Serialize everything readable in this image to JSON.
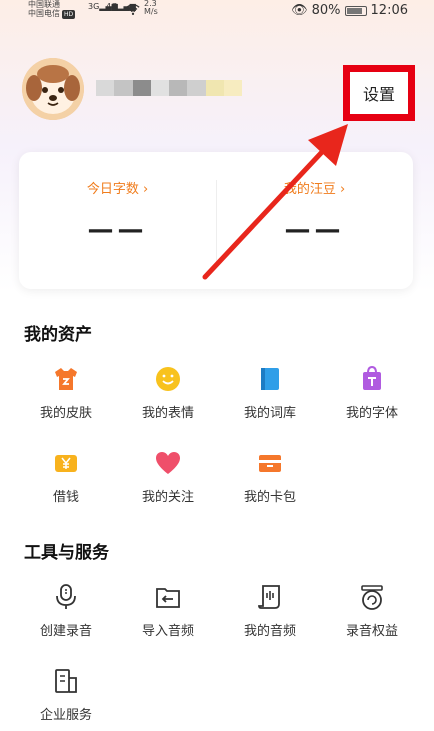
{
  "status_bar": {
    "carrier_1": "中国联通",
    "carrier_2": "中国电信",
    "hd": "HD",
    "signal_1": "3G",
    "signal_2": "4G",
    "speed_value": "2.3",
    "speed_unit": "M/s",
    "battery": "80%",
    "time": "12:06"
  },
  "header": {
    "settings_label": "设置"
  },
  "stats": {
    "words_label": "今日字数",
    "words_value": "——",
    "beans_label": "我的汪豆",
    "beans_value": "——"
  },
  "assets": {
    "title": "我的资产",
    "items": [
      {
        "label": "我的皮肤",
        "icon": "shirt-icon",
        "color": "#f5772b"
      },
      {
        "label": "我的表情",
        "icon": "smiley-icon",
        "color": "#f8c21d"
      },
      {
        "label": "我的词库",
        "icon": "book-icon",
        "color": "#2f9ee8"
      },
      {
        "label": "我的字体",
        "icon": "shopping-bag-icon",
        "color": "#b05be0"
      },
      {
        "label": "借钱",
        "icon": "yen-icon",
        "color": "#f8b21d"
      },
      {
        "label": "我的关注",
        "icon": "heart-icon",
        "color": "#ef4f6a"
      },
      {
        "label": "我的卡包",
        "icon": "card-wallet-icon",
        "color": "#f5772b"
      }
    ]
  },
  "tools": {
    "title": "工具与服务",
    "items": [
      {
        "label": "创建录音",
        "icon": "microphone-icon"
      },
      {
        "label": "导入音频",
        "icon": "import-folder-icon"
      },
      {
        "label": "我的音频",
        "icon": "audio-file-icon"
      },
      {
        "label": "录音权益",
        "icon": "recorder-rights-icon"
      },
      {
        "label": "企业服务",
        "icon": "enterprise-doc-icon"
      }
    ]
  }
}
